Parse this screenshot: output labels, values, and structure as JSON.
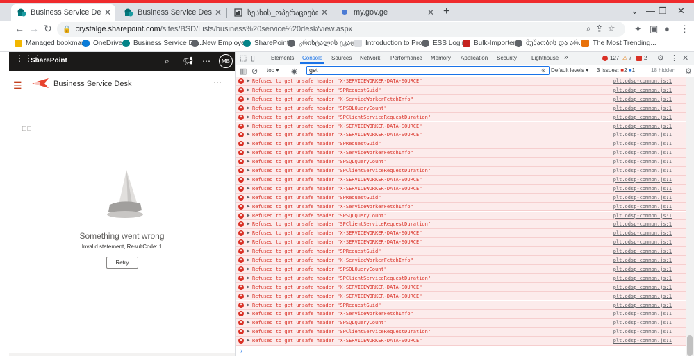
{
  "browser": {
    "tabs": [
      {
        "title": "Business Service Desk",
        "active": true,
        "icon": "sharepoint-icon"
      },
      {
        "title": "Business Service Desk - Business",
        "active": false,
        "icon": "sharepoint-icon"
      },
      {
        "title": "სესხის_ოპერაციები - SQL Ser",
        "active": false,
        "icon": "sql-icon"
      },
      {
        "title": "my.gov.ge",
        "active": false,
        "icon": "gov-icon"
      }
    ],
    "new_tab": "+",
    "window_controls": {
      "minimize": "—",
      "maximize": "❐",
      "close": "✕"
    },
    "url_host": "crystalge.sharepoint.com",
    "url_path": "/sites/BSD/Lists/business%20service%20desk/view.aspx",
    "bookmarks": [
      {
        "label": "Managed bookmarks",
        "color": "#f2b600"
      },
      {
        "label": "OneDrive",
        "color": "#0a7cd8"
      },
      {
        "label": "Business Service De...",
        "color": "#038387"
      },
      {
        "label": "New Employee",
        "color": "#5f6368"
      },
      {
        "label": "SharePoint",
        "color": "#038387"
      },
      {
        "label": "კრისტალის ეკად...",
        "color": "#5f6368"
      },
      {
        "label": "Introduction to Pro...",
        "color": "#dadce0"
      },
      {
        "label": "ESS Login",
        "color": "#5f6368"
      },
      {
        "label": "Bulk-Importer",
        "color": "#c5221f"
      },
      {
        "label": "მუშაობის და არ...",
        "color": "#5f6368"
      },
      {
        "label": "The Most Trending...",
        "color": "#e8710a"
      }
    ]
  },
  "sharepoint": {
    "brand": "SharePoint",
    "avatar": "MB",
    "site_title": "Business Service Desk",
    "error_title": "Something went wrong",
    "error_detail": "Invalid statement, ResultCode: 1",
    "retry_label": "Retry"
  },
  "devtools": {
    "tabs": [
      "Elements",
      "Console",
      "Sources",
      "Network",
      "Performance",
      "Memory",
      "Application",
      "Security",
      "Lighthouse"
    ],
    "active_tab": "Console",
    "more_tabs": "»",
    "error_count": "127",
    "warning_count": "7",
    "issue_count": "2",
    "context": "top",
    "filter_value": "get",
    "levels": "Default levels",
    "issues_label": "3 Issues:",
    "issues_errors": "2",
    "issues_info": "1",
    "hidden": "18 hidden",
    "log_source": "plt.odsp-common.js:1",
    "log_entries": [
      "Refused to get unsafe header \"X-SERVICEWORKER-DATA-SOURCE\"",
      "Refused to get unsafe header \"SPRequestGuid\"",
      "Refused to get unsafe header \"X-ServiceWorkerFetchInfo\"",
      "Refused to get unsafe header \"SPSQLQueryCount\"",
      "Refused to get unsafe header \"SPClientServiceRequestDuration\"",
      "Refused to get unsafe header \"X-SERVICEWORKER-DATA-SOURCE\"",
      "Refused to get unsafe header \"X-SERVICEWORKER-DATA-SOURCE\"",
      "Refused to get unsafe header \"SPRequestGuid\"",
      "Refused to get unsafe header \"X-ServiceWorkerFetchInfo\"",
      "Refused to get unsafe header \"SPSQLQueryCount\"",
      "Refused to get unsafe header \"SPClientServiceRequestDuration\"",
      "Refused to get unsafe header \"X-SERVICEWORKER-DATA-SOURCE\"",
      "Refused to get unsafe header \"X-SERVICEWORKER-DATA-SOURCE\"",
      "Refused to get unsafe header \"SPRequestGuid\"",
      "Refused to get unsafe header \"X-ServiceWorkerFetchInfo\"",
      "Refused to get unsafe header \"SPSQLQueryCount\"",
      "Refused to get unsafe header \"SPClientServiceRequestDuration\"",
      "Refused to get unsafe header \"X-SERVICEWORKER-DATA-SOURCE\"",
      "Refused to get unsafe header \"X-SERVICEWORKER-DATA-SOURCE\"",
      "Refused to get unsafe header \"SPRequestGuid\"",
      "Refused to get unsafe header \"X-ServiceWorkerFetchInfo\"",
      "Refused to get unsafe header \"SPSQLQueryCount\"",
      "Refused to get unsafe header \"SPClientServiceRequestDuration\"",
      "Refused to get unsafe header \"X-SERVICEWORKER-DATA-SOURCE\"",
      "Refused to get unsafe header \"X-SERVICEWORKER-DATA-SOURCE\"",
      "Refused to get unsafe header \"SPRequestGuid\"",
      "Refused to get unsafe header \"X-ServiceWorkerFetchInfo\"",
      "Refused to get unsafe header \"SPSQLQueryCount\"",
      "Refused to get unsafe header \"SPClientServiceRequestDuration\"",
      "Refused to get unsafe header \"X-SERVICEWORKER-DATA-SOURCE\""
    ],
    "prompt": "›"
  }
}
